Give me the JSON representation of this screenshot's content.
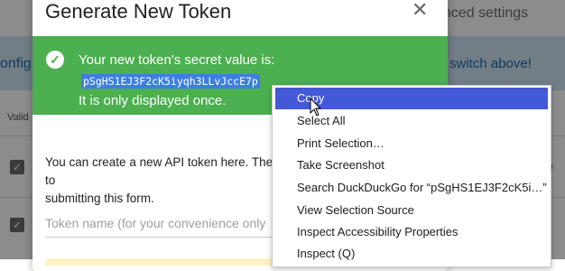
{
  "background": {
    "tab_label": "vanced settings",
    "banner_left": "onfig",
    "banner_right": "gs switch above!",
    "column_header": "Valid",
    "row_key": "ke"
  },
  "modal": {
    "title": "Generate New Token",
    "close_glyph": "✕",
    "alert": {
      "line1": "Your new token's secret value is:",
      "token": "pSgHS1EJ3F2cK5iyqh3LLvJccE7p",
      "line3": "It is only displayed once."
    },
    "description": "You can create a new API token here. The to  submitting this form.",
    "token_name_placeholder": "Token name (for your convenience only"
  },
  "context_menu": {
    "items": [
      {
        "label": "Copy",
        "active": true
      },
      {
        "label": "Select All"
      },
      {
        "label": "Print Selection…"
      },
      {
        "label": "Take Screenshot"
      },
      {
        "label": "Search DuckDuckGo for “pSgHS1EJ3F2cK5i…”"
      },
      {
        "label": "View Selection Source"
      },
      {
        "label": "Inspect Accessibility Properties"
      },
      {
        "label": "Inspect (Q)"
      }
    ]
  },
  "colors": {
    "alert_green": "#4caf50",
    "menu_highlight": "#4359d8",
    "selection_blue": "#3d7fe0"
  }
}
